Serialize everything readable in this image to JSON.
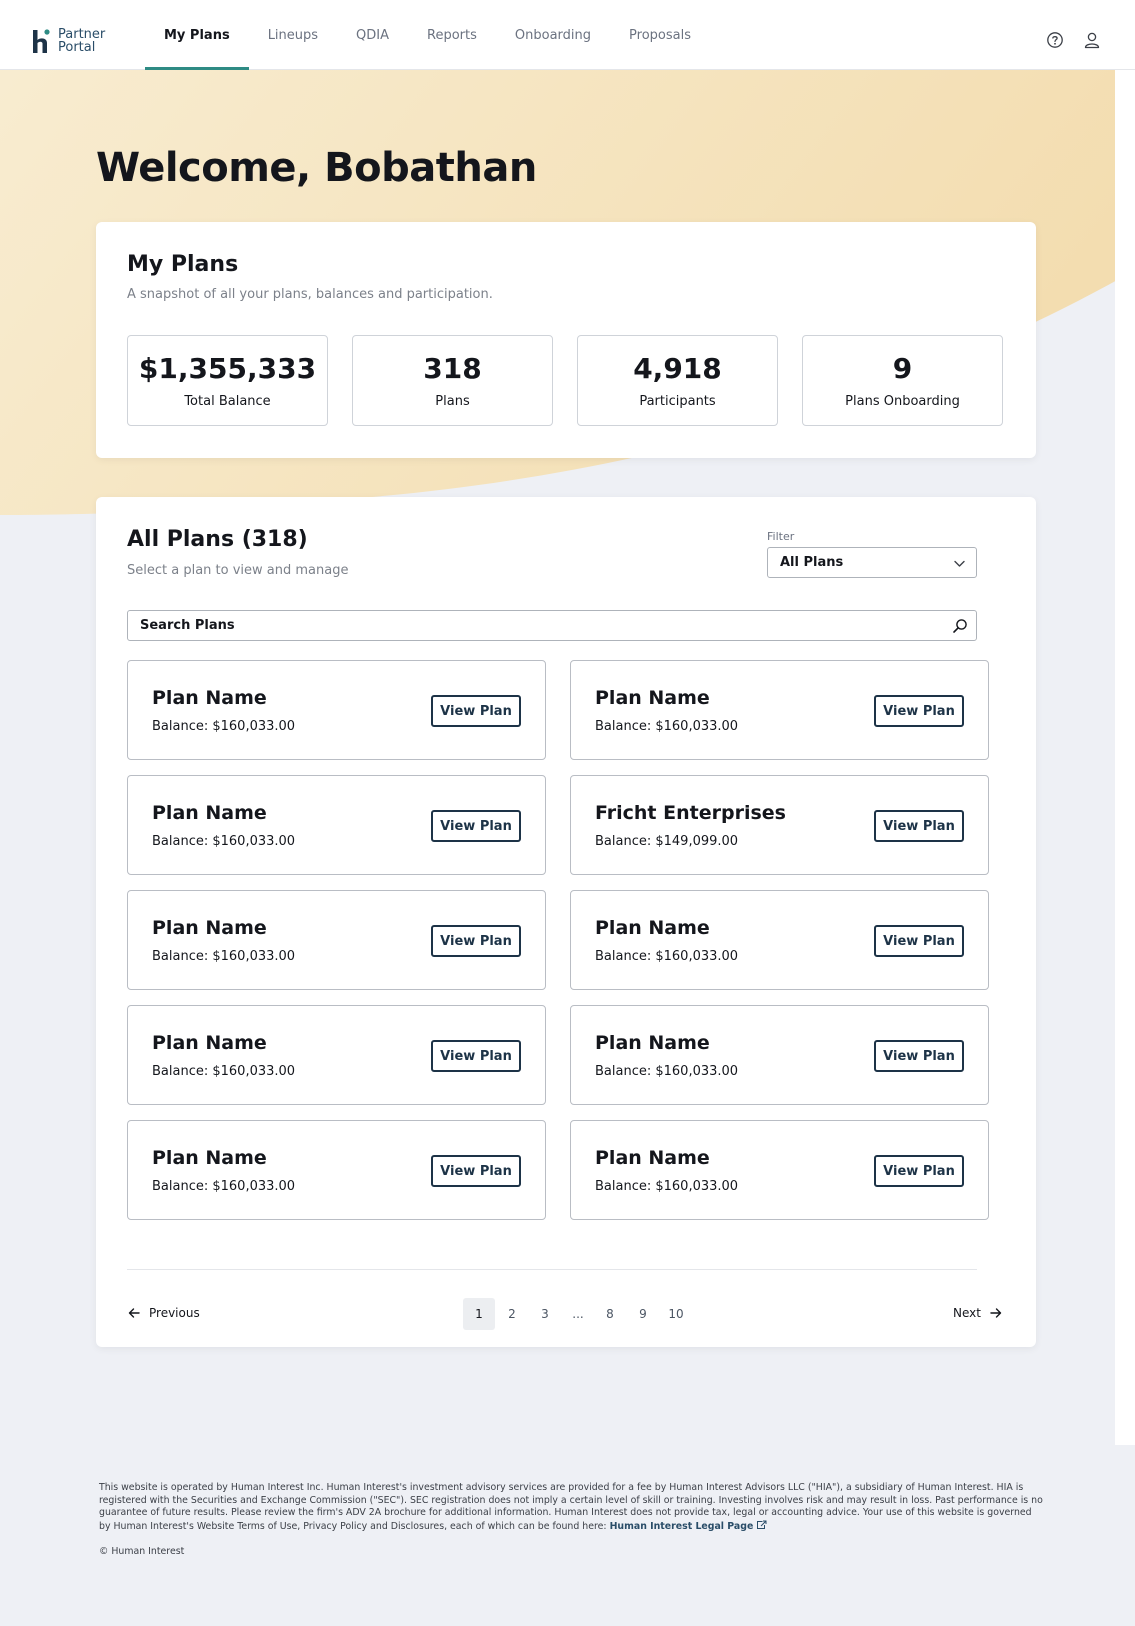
{
  "nav": {
    "logo_line1": "Partner",
    "logo_line2": "Portal",
    "items": [
      {
        "label": "My Plans",
        "active": true
      },
      {
        "label": "Lineups",
        "active": false
      },
      {
        "label": "QDIA",
        "active": false
      },
      {
        "label": "Reports",
        "active": false
      },
      {
        "label": "Onboarding",
        "active": false
      },
      {
        "label": "Proposals",
        "active": false
      }
    ],
    "icons": [
      "help-circle-icon",
      "user-icon"
    ]
  },
  "welcome": "Welcome, Bobathan",
  "summary": {
    "title": "My Plans",
    "subtitle": "A snapshot of all your plans, balances and participation.",
    "stats": [
      {
        "value": "$1,355,333",
        "label": "Total Balance"
      },
      {
        "value": "318",
        "label": "Plans"
      },
      {
        "value": "4,918",
        "label": "Participants"
      },
      {
        "value": "9",
        "label": "Plans Onboarding"
      }
    ]
  },
  "plans": {
    "title": "All Plans (318)",
    "subtitle": "Select a plan to view and manage",
    "filter_label": "Filter",
    "filter_value": "All Plans",
    "search_placeholder": "Search Plans",
    "button_label": "View Plan",
    "items": [
      {
        "name": "Plan Name",
        "balance": "Balance: $160,033.00"
      },
      {
        "name": "Plan Name",
        "balance": "Balance: $160,033.00"
      },
      {
        "name": "Plan Name",
        "balance": "Balance: $160,033.00"
      },
      {
        "name": "Fricht Enterprises",
        "balance": "Balance: $149,099.00"
      },
      {
        "name": "Plan Name",
        "balance": "Balance: $160,033.00"
      },
      {
        "name": "Plan Name",
        "balance": "Balance: $160,033.00"
      },
      {
        "name": "Plan Name",
        "balance": "Balance: $160,033.00"
      },
      {
        "name": "Plan Name",
        "balance": "Balance: $160,033.00"
      },
      {
        "name": "Plan Name",
        "balance": "Balance: $160,033.00"
      },
      {
        "name": "Plan Name",
        "balance": "Balance: $160,033.00"
      }
    ]
  },
  "pagination": {
    "previous": "Previous",
    "next": "Next",
    "pages": [
      "1",
      "2",
      "3",
      "...",
      "8",
      "9",
      "10"
    ],
    "current": "1"
  },
  "footer": {
    "disclaimer": "This website is operated by Human Interest Inc. Human Interest's investment advisory services are provided for a fee by Human Interest Advisors LLC (\"HIA\"), a subsidiary of Human Interest. HIA is registered with the Securities and Exchange Commission (\"SEC\"). SEC registration does not imply a certain level of skill or training. Investing involves risk and may result in loss. Past performance is no guarantee of future results. Please review the firm's ADV 2A brochure for additional information. Human Interest does not provide tax, legal or accounting advice. Your use of this website is governed by Human Interest's Website Terms of Use, Privacy Policy and Disclosures, each of which can be found here: ",
    "legal_link": "Human Interest Legal Page",
    "copyright": "© Human Interest"
  },
  "colors": {
    "accent_teal": "#2e8b84",
    "navy": "#1d3347",
    "hero_yellow": "#f5e2b8",
    "background": "#eef0f5"
  }
}
